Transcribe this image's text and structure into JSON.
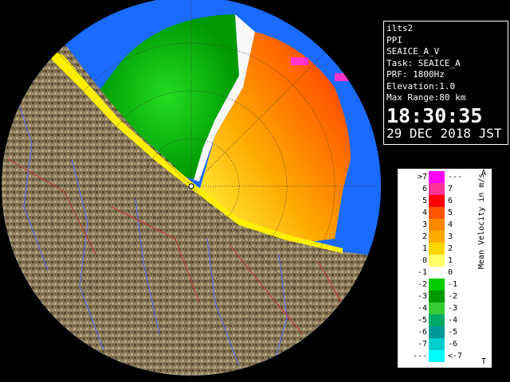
{
  "info": {
    "station": "ilts2",
    "mode": "PPI",
    "product": "SEAICE_A_V",
    "task": "Task: SEAICE_A",
    "prf": "PRF: 1800Hz",
    "elevation": "Elevation:1.0",
    "max_range": "Max Range:80 km",
    "time": "18:30:35",
    "date": "29 DEC 2018 JST"
  },
  "legend": {
    "title": "Mean Velocity in m/s",
    "corner_top": "A",
    "corner_bottom": "T",
    "rows": [
      {
        "left": ">7",
        "right": "---",
        "color": "#ff00ff"
      },
      {
        "left": "6",
        "right": "7",
        "color": "#ff3399"
      },
      {
        "left": "5",
        "right": "6",
        "color": "#ff0000"
      },
      {
        "left": "4",
        "right": "5",
        "color": "#ff5500"
      },
      {
        "left": "3",
        "right": "4",
        "color": "#ff8800"
      },
      {
        "left": "2",
        "right": "3",
        "color": "#ffaa00"
      },
      {
        "left": "1",
        "right": "2",
        "color": "#ffd700"
      },
      {
        "left": "0",
        "right": "1",
        "color": "#ffff66"
      },
      {
        "left": "-1",
        "right": "0",
        "color": "#ffffff"
      },
      {
        "left": "-2",
        "right": "-1",
        "color": "#00cc00"
      },
      {
        "left": "-3",
        "right": "-2",
        "color": "#009900"
      },
      {
        "left": "-4",
        "right": "-3",
        "color": "#33cc33"
      },
      {
        "left": "-5",
        "right": "-4",
        "color": "#00aa66"
      },
      {
        "left": "-6",
        "right": "-5",
        "color": "#009999"
      },
      {
        "left": "-7",
        "right": "-6",
        "color": "#00cccc"
      },
      {
        "left": "---",
        "right": "<-7",
        "color": "#00ffff"
      }
    ]
  }
}
